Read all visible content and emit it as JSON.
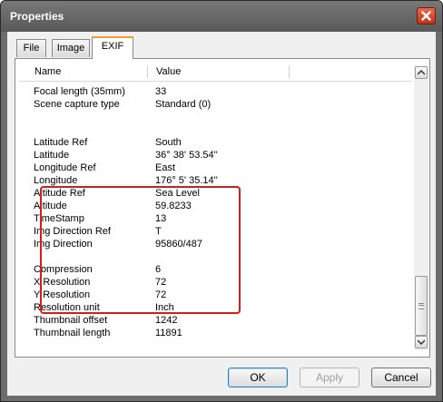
{
  "window": {
    "title": "Properties"
  },
  "tabs": [
    {
      "label": "File",
      "active": false
    },
    {
      "label": "Image",
      "active": false
    },
    {
      "label": "EXIF",
      "active": true
    }
  ],
  "list": {
    "columns": [
      "Name",
      "Value"
    ],
    "rows_top": [
      {
        "name": "Focal length (35mm)",
        "value": "33"
      },
      {
        "name": "Scene capture type",
        "value": "Standard (0)"
      }
    ],
    "rows_gps": [
      {
        "name": "Latitude Ref",
        "value": "South"
      },
      {
        "name": "Latitude",
        "value": "36° 38' 53.54''"
      },
      {
        "name": "Longitude Ref",
        "value": "East"
      },
      {
        "name": "Longitude",
        "value": "176° 5' 35.14''"
      },
      {
        "name": "Altitude Ref",
        "value": "Sea Level"
      },
      {
        "name": "Altitude",
        "value": "59.8233"
      },
      {
        "name": "TimeStamp",
        "value": "13"
      },
      {
        "name": "Img Direction Ref",
        "value": "T"
      },
      {
        "name": "Img Direction",
        "value": "95860/487"
      }
    ],
    "rows_bottom": [
      {
        "name": "Compression",
        "value": "6"
      },
      {
        "name": "X Resolution",
        "value": "72"
      },
      {
        "name": "Y Resolution",
        "value": "72"
      },
      {
        "name": "Resolution unit",
        "value": "Inch"
      },
      {
        "name": "Thumbnail offset",
        "value": "1242"
      },
      {
        "name": "Thumbnail length",
        "value": "11891"
      }
    ],
    "highlight_color": "#d81b1b"
  },
  "buttons": {
    "ok": "OK",
    "apply": "Apply",
    "cancel": "Cancel"
  },
  "icons": {
    "close": "close-icon",
    "scroll_up": "arrow-up-icon",
    "scroll_down": "arrow-down-icon"
  },
  "colors": {
    "titlebar": "#666666",
    "close_button": "#d24a2d",
    "active_tab_accent": "#f0a030"
  }
}
